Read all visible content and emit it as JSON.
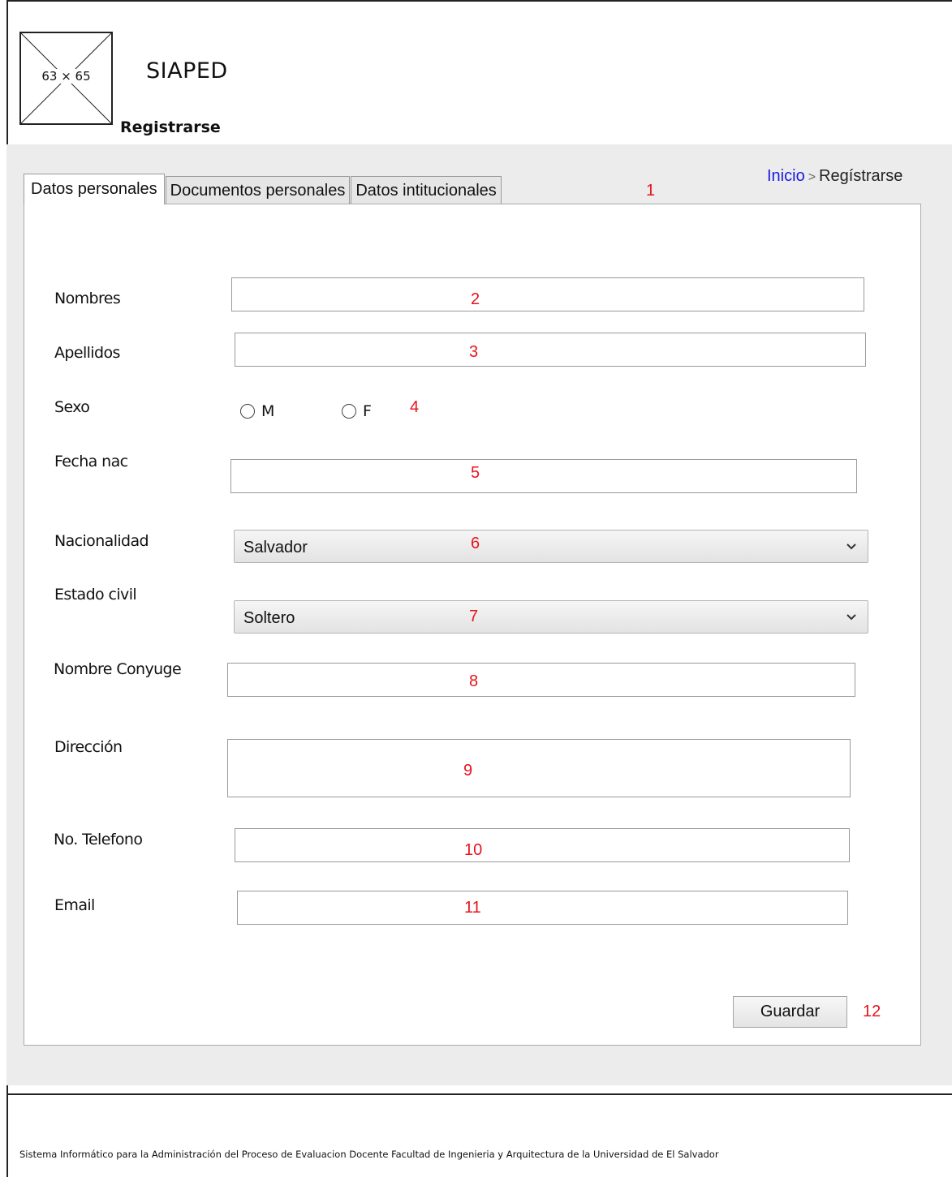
{
  "header": {
    "logo_placeholder": "63 × 65",
    "app_title": "SIAPED",
    "page_title": "Registrarse"
  },
  "breadcrumb": {
    "home": "Inicio",
    "separator": ">",
    "current": "Regístrarse"
  },
  "tabs": [
    {
      "label": "Datos personales",
      "active": true
    },
    {
      "label": "Documentos personales",
      "active": false
    },
    {
      "label": "Datos intitucionales",
      "active": false
    }
  ],
  "form": {
    "nombres": {
      "label": "Nombres",
      "value": ""
    },
    "apellidos": {
      "label": "Apellidos",
      "value": ""
    },
    "sexo": {
      "label": "Sexo",
      "options": [
        "M",
        "F"
      ]
    },
    "fecha_nac": {
      "label": "Fecha nac",
      "value": ""
    },
    "nacionalidad": {
      "label": "Nacionalidad",
      "selected": "Salvador"
    },
    "estado_civil": {
      "label": "Estado civil",
      "selected": "Soltero"
    },
    "nombre_conyuge": {
      "label": "Nombre Conyuge",
      "value": ""
    },
    "direccion": {
      "label": "Dirección",
      "value": ""
    },
    "telefono": {
      "label": "No. Telefono",
      "value": ""
    },
    "email": {
      "label": "Email",
      "value": ""
    },
    "save_label": "Guardar"
  },
  "annotations": [
    "1",
    "2",
    "3",
    "4",
    "5",
    "6",
    "7",
    "8",
    "9",
    "10",
    "11",
    "12"
  ],
  "footer": {
    "text": "Sistema Informático para la Administración del Proceso de Evaluacion Docente  Facultad de Ingenieria y Arquitectura de la Universidad de El Salvador"
  },
  "colors": {
    "annotation": "#e8131b",
    "link": "#1a1ae6",
    "panel_bg": "#ececec"
  }
}
